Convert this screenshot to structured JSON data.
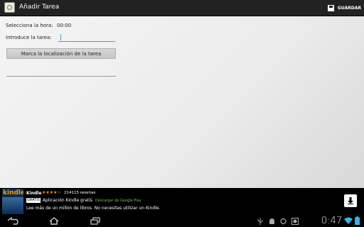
{
  "action_bar": {
    "title": "Añadir Tarea",
    "save_label": "GUARDAR",
    "app_icon": "app-badge-icon",
    "save_icon": "floppy-disk-icon"
  },
  "form": {
    "hour_label": "Selecciona la hora:",
    "hour_value": "00:00",
    "task_label": "Introduce la tarea:",
    "task_value": "",
    "location_button": "Marca la localización de la tarea"
  },
  "ad": {
    "logo_text": "kindle",
    "title": "Kindle",
    "stars": "★★★★☆",
    "rating": 4,
    "reviews": "214115 reseñas",
    "badge": "GRATIS",
    "subtitle": "Aplicación Kindle gratis",
    "store_text": "Descargar de Google Play",
    "description": "Lee más de un millón de libros. No necesitas utilizar un Kindle.",
    "download_icon": "download-arrow-icon"
  },
  "system_bar": {
    "time": "0:47",
    "nav_icons": [
      "back-icon",
      "home-icon",
      "recent-apps-icon"
    ],
    "status_icons": [
      "usb-icon",
      "android-debug-icon",
      "sync-icon",
      "image-icon",
      "wifi-icon",
      "battery-icon"
    ]
  },
  "colors": {
    "action_bar": "#222222",
    "accent": "#3aa6d0",
    "ad_background": "#000000",
    "kindle_orange": "#f3a000",
    "store_green": "#7cc142"
  }
}
